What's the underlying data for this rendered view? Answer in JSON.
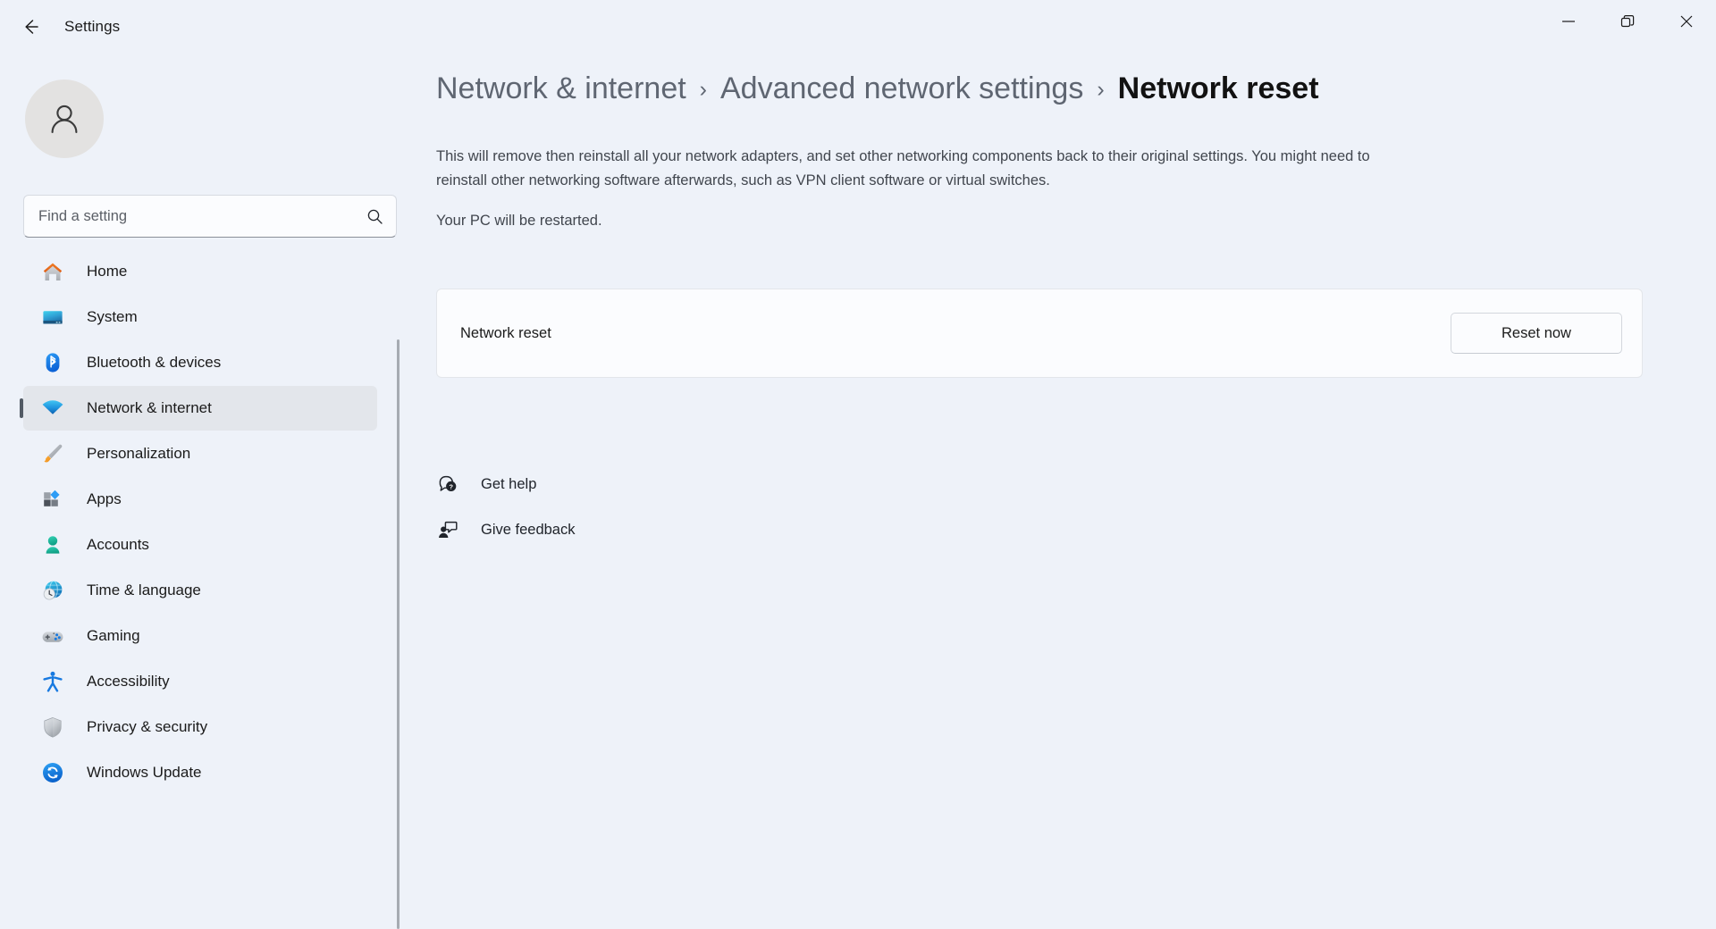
{
  "window": {
    "title": "Settings",
    "back_label": "Back",
    "controls": {
      "minimize": "Minimize",
      "maximize": "Restore",
      "close": "Close"
    }
  },
  "sidebar": {
    "account_avatar": "user-avatar",
    "search": {
      "placeholder": "Find a setting",
      "value": "",
      "icon": "search-icon"
    },
    "items": [
      {
        "label": "Home",
        "icon": "home-icon",
        "selected": false
      },
      {
        "label": "System",
        "icon": "system-icon",
        "selected": false
      },
      {
        "label": "Bluetooth & devices",
        "icon": "bluetooth-icon",
        "selected": false
      },
      {
        "label": "Network & internet",
        "icon": "wifi-icon",
        "selected": true
      },
      {
        "label": "Personalization",
        "icon": "paintbrush-icon",
        "selected": false
      },
      {
        "label": "Apps",
        "icon": "apps-icon",
        "selected": false
      },
      {
        "label": "Accounts",
        "icon": "accounts-icon",
        "selected": false
      },
      {
        "label": "Time & language",
        "icon": "clock-globe-icon",
        "selected": false
      },
      {
        "label": "Gaming",
        "icon": "gamepad-icon",
        "selected": false
      },
      {
        "label": "Accessibility",
        "icon": "accessibility-icon",
        "selected": false
      },
      {
        "label": "Privacy & security",
        "icon": "shield-icon",
        "selected": false
      },
      {
        "label": "Windows Update",
        "icon": "update-icon",
        "selected": false
      }
    ]
  },
  "main": {
    "breadcrumb": {
      "items": [
        "Network & internet",
        "Advanced network settings",
        "Network reset"
      ],
      "separator": "›"
    },
    "description": "This will remove then reinstall all your network adapters, and set other networking components back to their original settings. You might need to reinstall other networking software afterwards, such as VPN client software or virtual switches.",
    "description_secondary": "Your PC will be restarted.",
    "card": {
      "label": "Network reset",
      "button_label": "Reset now"
    },
    "links": [
      {
        "label": "Get help",
        "icon": "help-question-bubble-icon"
      },
      {
        "label": "Give feedback",
        "icon": "feedback-person-bubble-icon"
      }
    ]
  },
  "annotation": {
    "arrow_color": "#e8392f",
    "points_to": "Reset now"
  },
  "colors": {
    "page_background": "#eef2f9",
    "card_background": "#fbfcfe",
    "selected_nav": "#e3e6eb",
    "accent_indicator": "#525a64",
    "breadcrumb_muted": "#5f6672",
    "breadcrumb_current": "#121212"
  }
}
